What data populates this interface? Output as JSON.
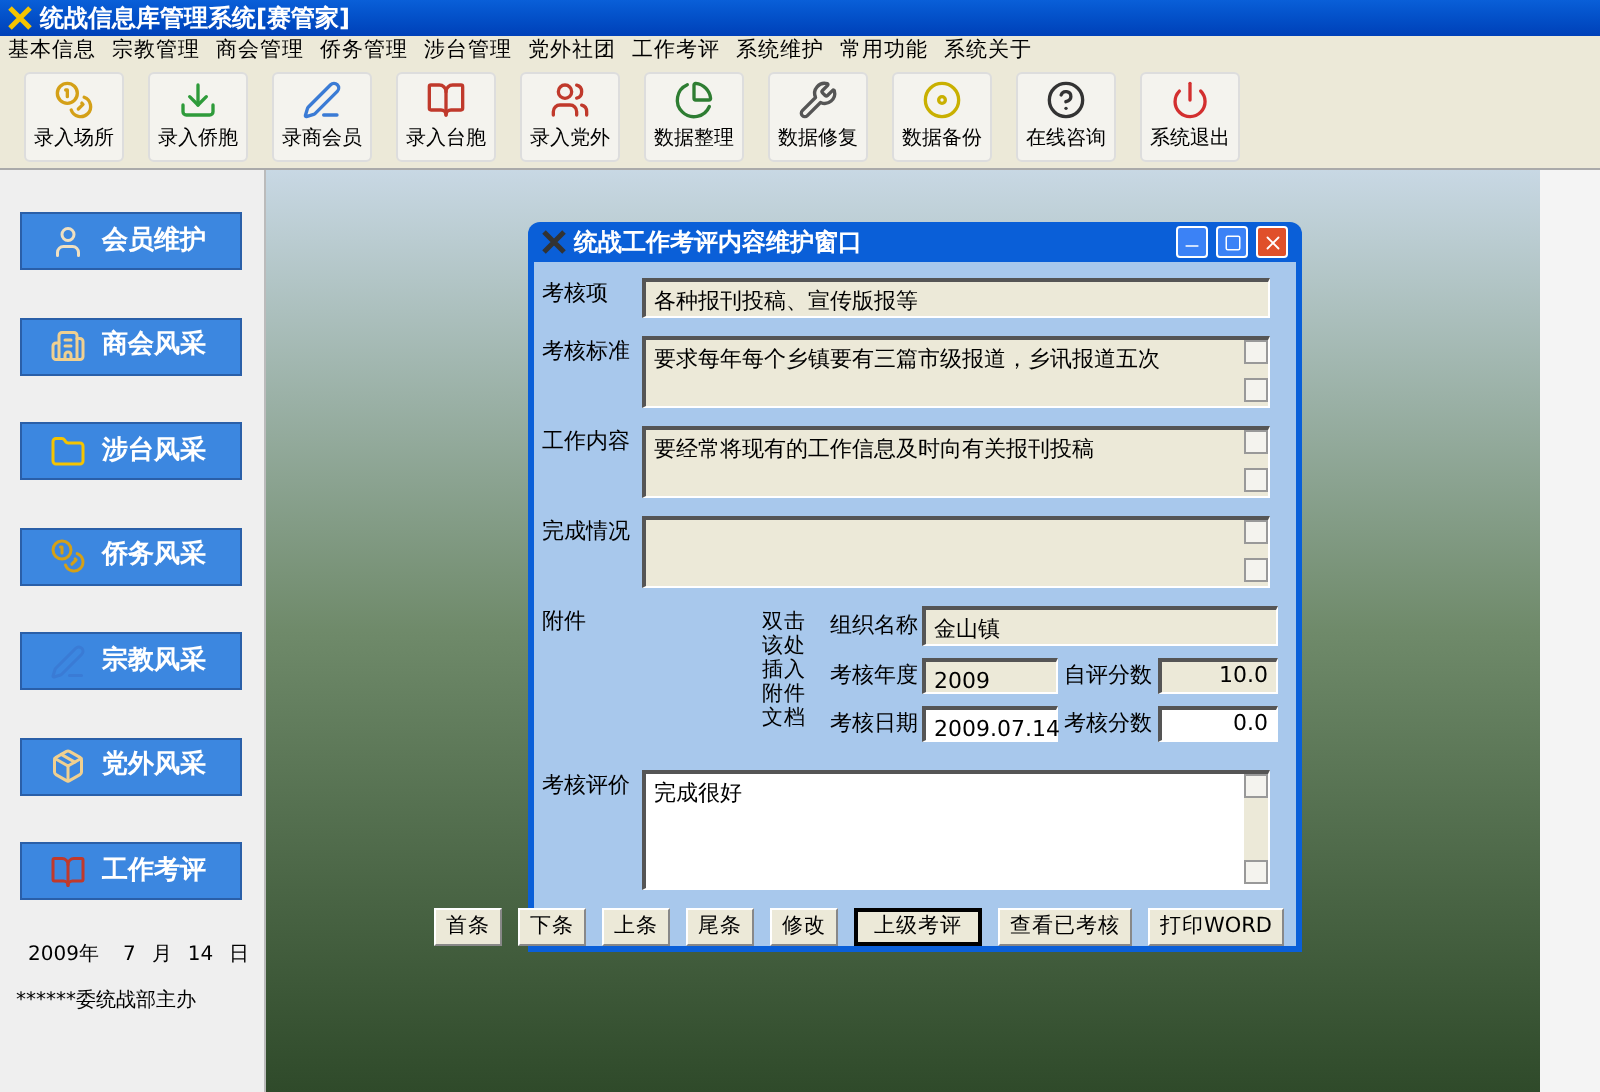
{
  "window": {
    "title": "统战信息库管理系统[赛管家]"
  },
  "menu": [
    "基本信息",
    "宗教管理",
    "商会管理",
    "侨务管理",
    "涉台管理",
    "党外社团",
    "工作考评",
    "系统维护",
    "常用功能",
    "系统关于"
  ],
  "toolbar": [
    {
      "label": "录入场所",
      "kind": "coins"
    },
    {
      "label": "录入侨胞",
      "kind": "download"
    },
    {
      "label": "录商会员",
      "kind": "pen"
    },
    {
      "label": "录入台胞",
      "kind": "books"
    },
    {
      "label": "录入党外",
      "kind": "users"
    },
    {
      "label": "数据整理",
      "kind": "pie"
    },
    {
      "label": "数据修复",
      "kind": "wrench"
    },
    {
      "label": "数据备份",
      "kind": "disc"
    },
    {
      "label": "在线咨询",
      "kind": "help"
    },
    {
      "label": "系统退出",
      "kind": "power"
    }
  ],
  "sidebar": {
    "items": [
      {
        "label": "会员维护",
        "kind": "user"
      },
      {
        "label": "商会风采",
        "kind": "building"
      },
      {
        "label": "涉台风采",
        "kind": "folder"
      },
      {
        "label": "侨务风采",
        "kind": "coins"
      },
      {
        "label": "宗教风采",
        "kind": "pen"
      },
      {
        "label": "党外风采",
        "kind": "package"
      },
      {
        "label": "工作考评",
        "kind": "books"
      }
    ],
    "date": {
      "year": "2009年",
      "month": "7",
      "month_unit": "月",
      "day": "14",
      "day_unit": "日"
    },
    "footer": "******委统战部主办"
  },
  "dialog": {
    "title": "统战工作考评内容维护窗口",
    "fields": [
      {
        "label": "考核项",
        "value": "各种报刊投稿、宣传版报等",
        "kind": "line",
        "editable": false
      },
      {
        "label": "考核标准",
        "value": "要求每年每个乡镇要有三篇市级报道，乡讯报道五次",
        "kind": "area",
        "editable": false
      },
      {
        "label": "工作内容",
        "value": "要经常将现有的工作信息及时向有关报刊投稿",
        "kind": "area",
        "editable": false
      },
      {
        "label": "完成情况",
        "kind": "area",
        "editable": false
      }
    ],
    "attachment": {
      "label": "附件",
      "hint": "双击该处插入附件文档"
    },
    "org": {
      "label": "组织名称",
      "value": "金山镇",
      "editable": false
    },
    "year": {
      "label": "考核年度",
      "value": "2009",
      "editable": false
    },
    "self_score": {
      "label": "自评分数",
      "value": "10.0",
      "editable": false
    },
    "date": {
      "label": "考核日期",
      "value": "2009.07.14",
      "editable": true
    },
    "score": {
      "label": "考核分数",
      "value": "0.0",
      "editable": true
    },
    "review": {
      "label": "考核评价",
      "value": "完成很好",
      "editable": true
    },
    "buttons": [
      {
        "label": "首条",
        "default": false
      },
      {
        "label": "下条",
        "default": false
      },
      {
        "label": "上条",
        "default": false
      },
      {
        "label": "尾条",
        "default": false
      },
      {
        "label": "修改",
        "default": false
      },
      {
        "label": "上级考评",
        "default": true
      },
      {
        "label": "查看已考核",
        "default": false
      },
      {
        "label": "打印WORD",
        "default": false
      }
    ]
  }
}
